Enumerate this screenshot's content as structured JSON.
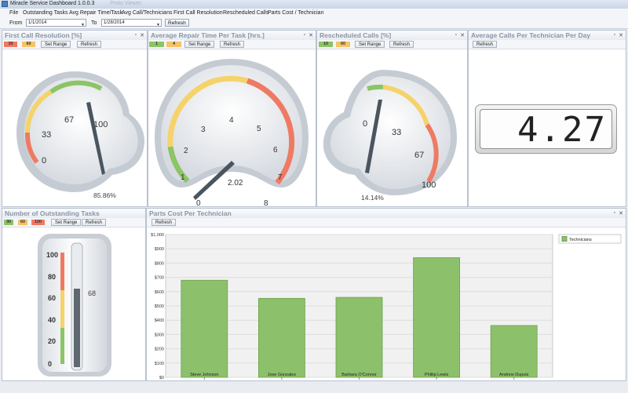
{
  "window": {
    "title": "Miracle Service Dashboard 1.0.0.3",
    "title_faint": "Proto Viewer"
  },
  "menu": {
    "items": [
      {
        "label": "File"
      },
      {
        "label": "Outstanding Tasks"
      },
      {
        "label": "Avg Repair Time/Task"
      },
      {
        "label": "Avg Call/Technicians"
      },
      {
        "label": "First Call Resolution"
      },
      {
        "label": "Rescheduled Calls"
      },
      {
        "label": "Parts Cost / Technician"
      }
    ]
  },
  "toolbar": {
    "from_label": "From",
    "from_value": "1/1/2014",
    "to_label": "To",
    "to_value": "1/28/2014",
    "refresh_label": "Refresh"
  },
  "panels": {
    "first_call": {
      "title": "First Call Resolution [%]",
      "chips": [
        "30",
        "60"
      ],
      "set_range": "Set Range",
      "refresh": "Refresh",
      "scale": [
        "0",
        "33",
        "67",
        "100"
      ],
      "value": 85.86,
      "value_text": "85.86%"
    },
    "repair_time": {
      "title": "Average Repair Time Per Task [hrs.]",
      "chips": [
        "1",
        "4"
      ],
      "set_range": "Set Range",
      "refresh": "Refresh",
      "scale": [
        "0",
        "1",
        "2",
        "3",
        "4",
        "5",
        "6",
        "7",
        "8"
      ],
      "value": 2.02,
      "value_text": "2.02"
    },
    "rescheduled": {
      "title": "Rescheduled Calls [%]",
      "chips": [
        "10",
        "60"
      ],
      "set_range": "Set Range",
      "refresh": "Refresh",
      "scale": [
        "0",
        "33",
        "67",
        "100"
      ],
      "value": 14.14,
      "value_text": "14.14%"
    },
    "avg_calls": {
      "title": "Average Calls Per Technician Per Day",
      "refresh": "Refresh",
      "value_text": "4.27"
    },
    "outstanding": {
      "title": "Number of Outstanding Tasks",
      "chips": [
        "30",
        "60",
        "100"
      ],
      "set_range": "Set Range",
      "refresh": "Refresh",
      "scale": [
        "0",
        "20",
        "40",
        "60",
        "80",
        "100"
      ],
      "value": 68,
      "value_text": "68"
    },
    "parts_cost": {
      "title": "Parts Cost Per Technician",
      "refresh": "Refresh"
    }
  },
  "colors": {
    "green": "#8cc466",
    "yellow": "#f5d36a",
    "red": "#ef7a64",
    "bar": "#8cc06b",
    "bar_edge": "#6fa14e",
    "needle": "#4a5560"
  },
  "chart_data": {
    "type": "bar",
    "categories": [
      "Steve Johnson",
      "Jose Gonzalez",
      "Barbara O'Connor",
      "Phillip Lewis",
      "Andrew Dupuis"
    ],
    "series": [
      {
        "name": "Technicians",
        "values": [
          680,
          553,
          560,
          838,
          363
        ]
      }
    ],
    "ylim": [
      0,
      1000
    ],
    "yticks": [
      "$0",
      "$100",
      "$200",
      "$300",
      "$400",
      "$500",
      "$600",
      "$700",
      "$800",
      "$900",
      "$1,000"
    ],
    "ytick_values": [
      0,
      100,
      200,
      300,
      400,
      500,
      600,
      700,
      800,
      900,
      1000
    ],
    "legend": "top-right"
  }
}
